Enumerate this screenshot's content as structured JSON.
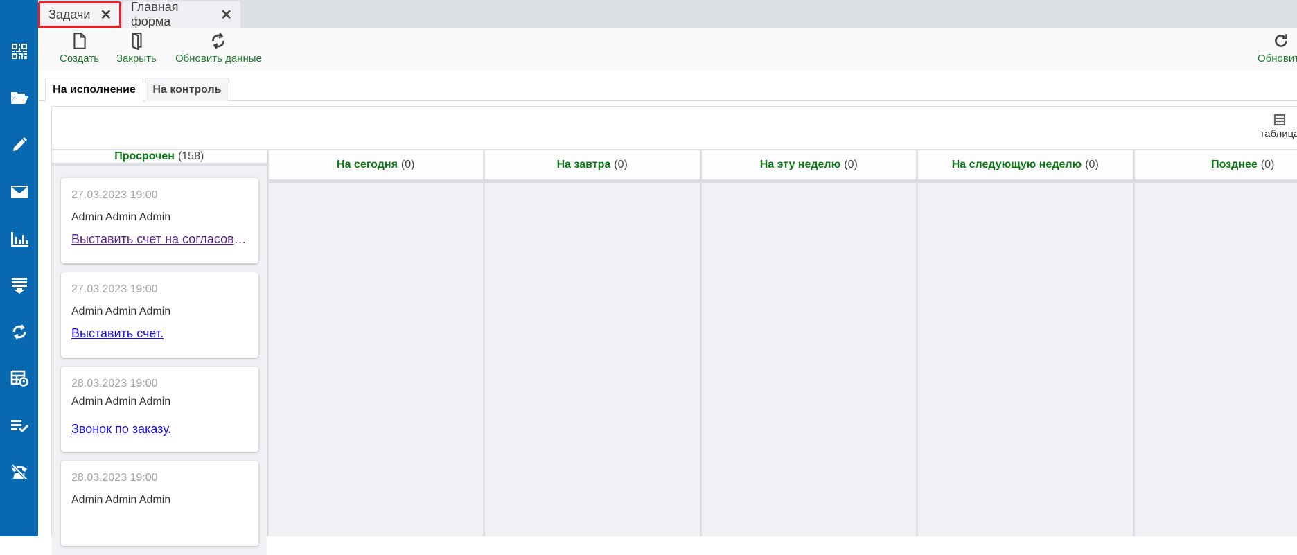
{
  "colors": {
    "sidebar": "#0869b1",
    "accent_green": "#0b7a12",
    "active_tab_border": "#e8202a"
  },
  "sidebar": {
    "icons": [
      "qr-code-icon",
      "folder-open-icon",
      "pencil-icon",
      "envelope-icon",
      "bar-chart-icon",
      "import-list-icon",
      "sync-icon",
      "calendar-table-icon",
      "checklist-icon",
      "phone-disabled-icon"
    ]
  },
  "doc_tabs": [
    {
      "label": "Задачи",
      "active": true
    },
    {
      "label": "Главная форма",
      "active": false
    }
  ],
  "toolbar": {
    "create": "Создать",
    "close": "Закрыть",
    "refresh_data": "Обновить данные",
    "refresh": "Обновить"
  },
  "subtabs": [
    {
      "label": "На исполнение"
    },
    {
      "label": "На контроль"
    }
  ],
  "board": {
    "view_toggle": "таблица",
    "columns": [
      {
        "title": "Просрочен",
        "count": "(158)"
      },
      {
        "title": "На сегодня",
        "count": "(0)"
      },
      {
        "title": "На завтра",
        "count": "(0)"
      },
      {
        "title": "На эту неделю",
        "count": "(0)"
      },
      {
        "title": "На следующую неделю",
        "count": "(0)"
      },
      {
        "title": "Позднее",
        "count": "(0)"
      }
    ],
    "cards": [
      {
        "date": "27.03.2023 19:00",
        "author": "Admin Admin Admin",
        "title": "Выставить счет на согласование"
      },
      {
        "date": "27.03.2023 19:00",
        "author": "Admin Admin Admin",
        "title": "Выставить счет."
      },
      {
        "date": "28.03.2023 19:00",
        "author": "Admin Admin Admin",
        "title": "Звонок по заказу."
      },
      {
        "date": "28.03.2023 19:00",
        "author": "Admin Admin Admin",
        "title": ""
      }
    ]
  }
}
